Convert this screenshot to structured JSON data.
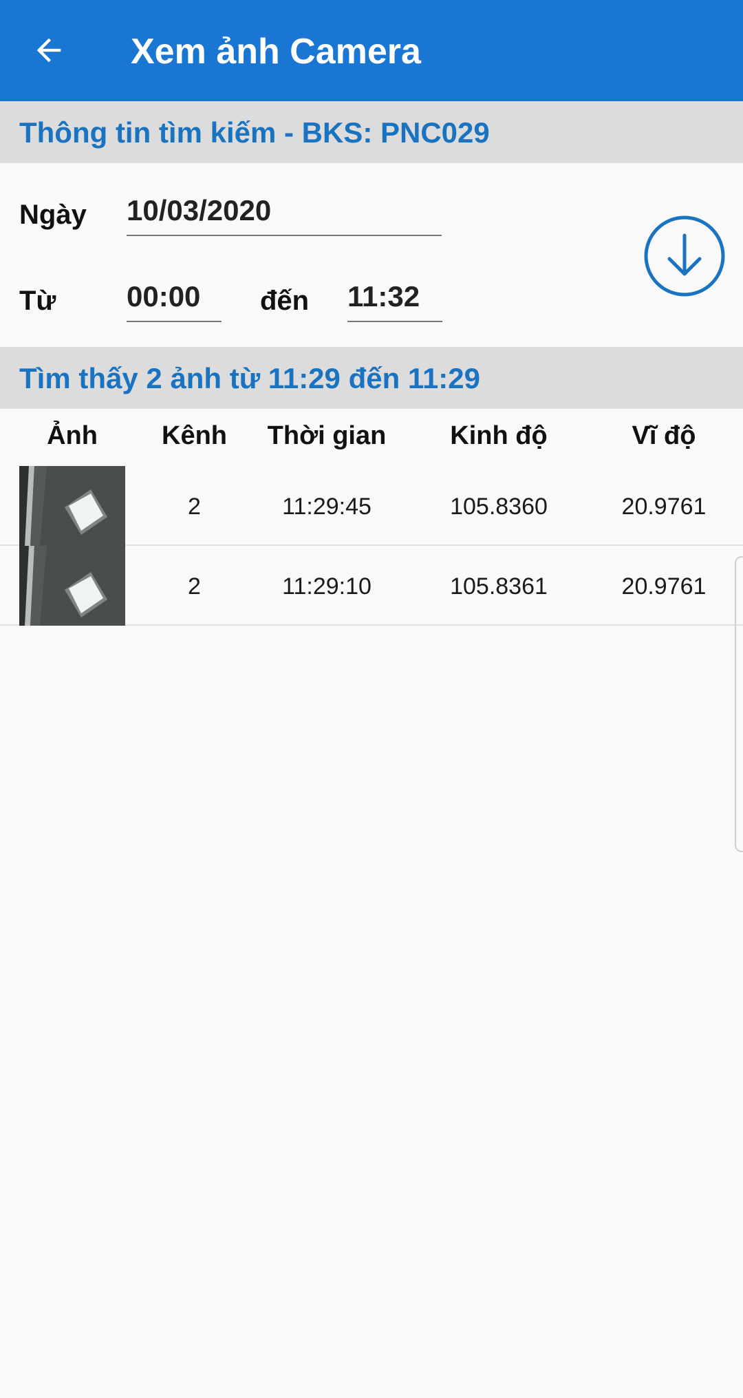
{
  "appbar": {
    "title": "Xem ảnh Camera",
    "back_icon": "arrow-left-icon"
  },
  "search": {
    "header": "Thông tin tìm kiếm - BKS: PNC029",
    "date_label": "Ngày",
    "date_value": "10/03/2020",
    "from_label": "Từ",
    "from_value": "00:00",
    "to_label": "đến",
    "to_value": "11:32",
    "download_icon": "arrow-down-circle-icon"
  },
  "results": {
    "header": "Tìm thấy 2 ảnh từ 11:29 đến 11:29",
    "columns": [
      "Ảnh",
      "Kênh",
      "Thời gian",
      "Kinh độ",
      "Vĩ độ"
    ],
    "rows": [
      {
        "channel": "2",
        "time": "11:29:45",
        "longitude": "105.8360",
        "latitude": "20.9761"
      },
      {
        "channel": "2",
        "time": "11:29:10",
        "longitude": "105.8361",
        "latitude": "20.9761"
      }
    ]
  },
  "colors": {
    "appbar": "#1976d2",
    "accent_text": "#1a73c0",
    "section_bg": "#dcdcdc",
    "page_bg": "#f9f9f9"
  }
}
